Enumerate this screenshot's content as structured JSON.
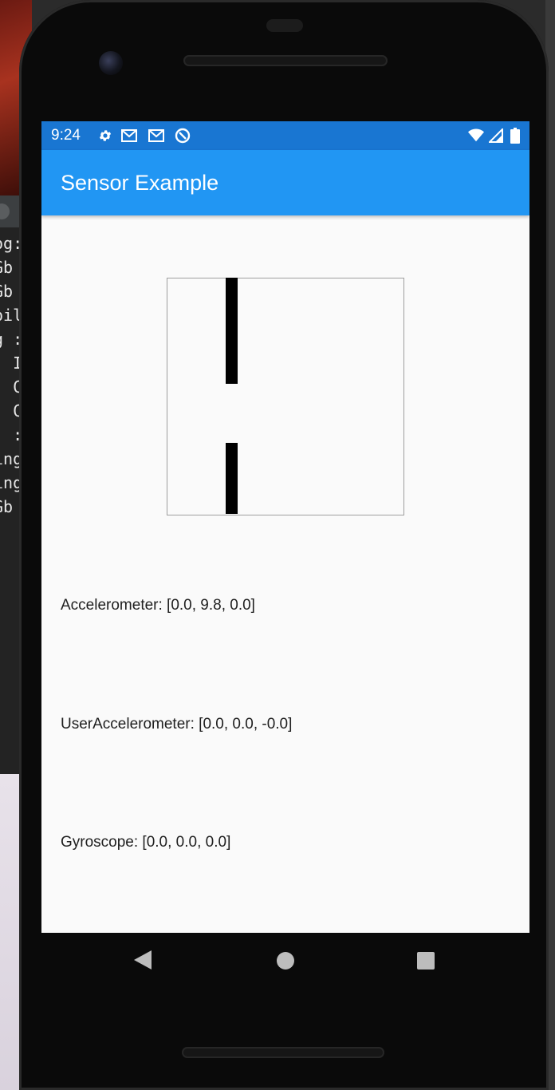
{
  "status_bar": {
    "time": "9:24",
    "left_icons": [
      "settings-icon",
      "gmail-icon",
      "gmail-icon",
      "at-sign-icon"
    ],
    "right_icons": [
      "wifi-icon",
      "cell-signal-icon",
      "battery-icon"
    ]
  },
  "app_bar": {
    "title": "Sensor Example",
    "color": "#2196f3"
  },
  "snake_game": {
    "cell_color": "#000000",
    "cells": [
      {
        "col": 5,
        "row": 0
      },
      {
        "col": 5,
        "row": 1
      },
      {
        "col": 5,
        "row": 2
      },
      {
        "col": 5,
        "row": 3
      },
      {
        "col": 5,
        "row": 4
      },
      {
        "col": 5,
        "row": 5
      },
      {
        "col": 5,
        "row": 6
      },
      {
        "col": 5,
        "row": 7
      },
      {
        "col": 5,
        "row": 8
      },
      {
        "col": 5,
        "row": 14
      },
      {
        "col": 5,
        "row": 15
      },
      {
        "col": 5,
        "row": 16
      },
      {
        "col": 5,
        "row": 17
      },
      {
        "col": 5,
        "row": 18
      },
      {
        "col": 5,
        "row": 19
      }
    ]
  },
  "readings": {
    "accelerometer": "Accelerometer: [0.0, 9.8, 0.0]",
    "user_accelerometer": "UserAccelerometer: [0.0, 0.0, -0.0]",
    "gyroscope": "Gyroscope: [0.0, 0.0, 0.0]"
  },
  "nav_bar": {
    "buttons": [
      "back-icon",
      "home-icon",
      "recents-icon"
    ]
  },
  "background": {
    "terminal_fragments": [
      "og:",
      "Gb",
      "Gb",
      "oil",
      "g :",
      ": I",
      ": C",
      ": C",
      ": :",
      "ing",
      "ing",
      "Gb"
    ]
  }
}
